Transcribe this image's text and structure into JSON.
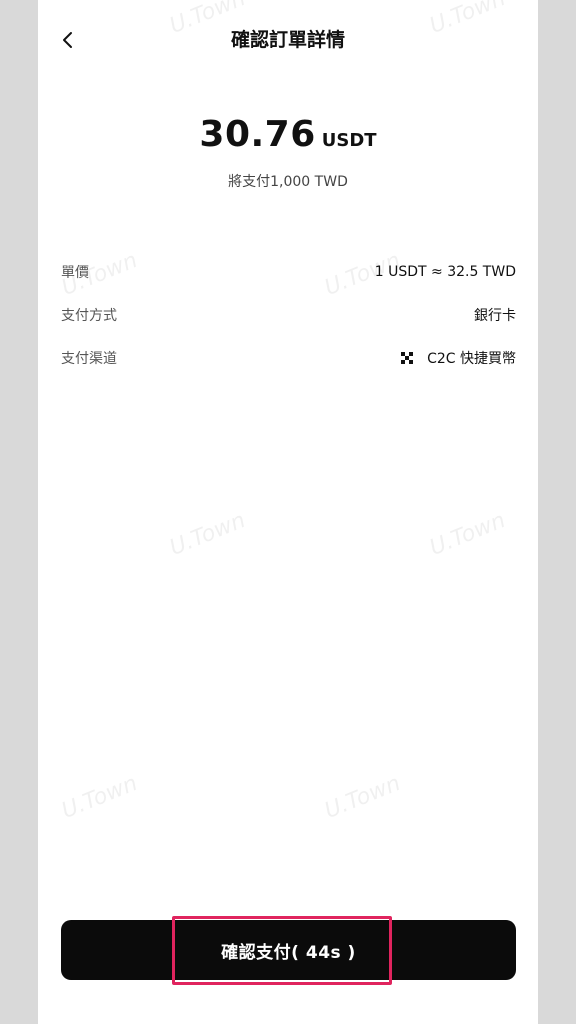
{
  "header": {
    "title": "確認訂單詳情"
  },
  "summary": {
    "amount": "30.76",
    "unit": "USDT",
    "pay_note": "將支付1,000 TWD"
  },
  "details": [
    {
      "label": "單價",
      "value": "1 USDT ≈ 32.5 TWD"
    },
    {
      "label": "支付方式",
      "value": "銀行卡"
    },
    {
      "label": "支付渠道",
      "value": "C2C 快捷買幣",
      "icon": "c2c-icon"
    }
  ],
  "action": {
    "confirm_label": "確認支付( 44s )"
  },
  "watermark": "U.Town"
}
